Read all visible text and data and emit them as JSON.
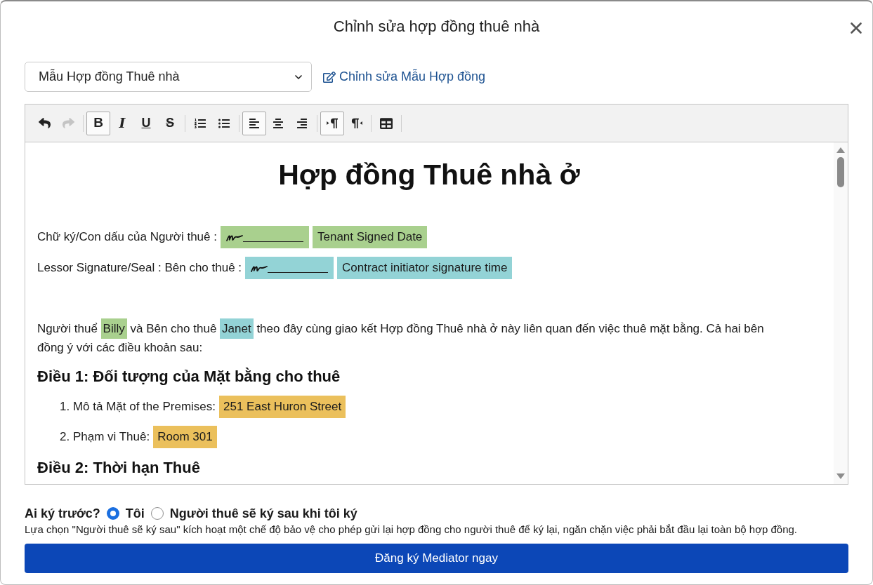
{
  "dialog": {
    "title": "Chỉnh sửa hợp đồng thuê nhà"
  },
  "template_select": {
    "value": "Mẫu Hợp đồng Thuê nhà"
  },
  "edit_template_link": {
    "label": "Chỉnh sửa Mẫu Hợp đồng"
  },
  "toolbar": {
    "groups": [
      [
        {
          "kind": "undo",
          "active": false,
          "disabled": false
        },
        {
          "kind": "redo",
          "active": false,
          "disabled": true
        }
      ],
      [
        {
          "kind": "bold",
          "glyph": "B",
          "active": true,
          "disabled": false
        },
        {
          "kind": "italic",
          "glyph": "I",
          "active": false,
          "disabled": false
        },
        {
          "kind": "underline",
          "glyph": "U",
          "active": false,
          "disabled": false
        },
        {
          "kind": "strike",
          "glyph": "S",
          "active": false,
          "disabled": false
        }
      ],
      [
        {
          "kind": "ordered_list",
          "active": false,
          "disabled": false
        },
        {
          "kind": "bullet_list",
          "active": false,
          "disabled": false
        }
      ],
      [
        {
          "kind": "align_left",
          "active": true,
          "disabled": false
        },
        {
          "kind": "align_center",
          "active": false,
          "disabled": false
        },
        {
          "kind": "align_right",
          "active": false,
          "disabled": false
        }
      ],
      [
        {
          "kind": "ltr",
          "active": true,
          "disabled": false
        },
        {
          "kind": "rtl",
          "active": false,
          "disabled": false
        }
      ],
      [
        {
          "kind": "table",
          "active": false,
          "disabled": false
        }
      ]
    ]
  },
  "document": {
    "title": "Hợp đồng Thuê nhà ở",
    "signature_lines": [
      {
        "label": "Chữ ký/Con dấu của Người thuê :",
        "date_field": "Tenant Signed Date",
        "color": "#a9d08e"
      },
      {
        "label": "Lessor Signature/Seal : Bên cho thuê :",
        "date_field": "Contract initiator signature time",
        "color": "#93d3d6"
      }
    ],
    "intro": [
      {
        "kind": "text",
        "text": "Người thuể "
      },
      {
        "kind": "field",
        "text": "Billy",
        "color": "#a9d08e"
      },
      {
        "kind": "text",
        "text": " và Bên cho thuê "
      },
      {
        "kind": "field",
        "text": "Janet",
        "color": "#93d3d6"
      },
      {
        "kind": "text",
        "text": " theo đây cùng giao kết Hợp đồng Thuê nhà ở này liên quan đến việc thuê mặt bằng. Cả hai bên đồng ý với các điều khoản sau:"
      }
    ],
    "sections": [
      {
        "heading": "Điều 1: Đối tượng của Mặt bằng cho thuê",
        "items": [
          {
            "label": "1. Mô tả Mặt of the Premises:",
            "value": "251 East Huron Street",
            "color": "#ebc05c"
          },
          {
            "label": "2. Phạm vi Thuê:",
            "value": "Room 301",
            "color": "#ebc05c"
          }
        ]
      },
      {
        "heading": "Điều 2: Thời hạn Thuê"
      }
    ]
  },
  "signing_order": {
    "label": "Ai ký trước?",
    "options": [
      {
        "label": "Tôi",
        "selected": true
      },
      {
        "label": "Người thuê sẽ ký sau khi tôi ký",
        "selected": false
      }
    ],
    "note": "Lựa chọn \"Người thuê sẽ ký sau\" kích hoạt một chế độ bảo vệ cho phép gửi lại hợp đồng cho người thuê để ký lại, ngăn chặn việc phải bắt đầu lại toàn bộ hợp đồng."
  },
  "submit_button": {
    "label": "Đăng ký Mediator ngay"
  }
}
